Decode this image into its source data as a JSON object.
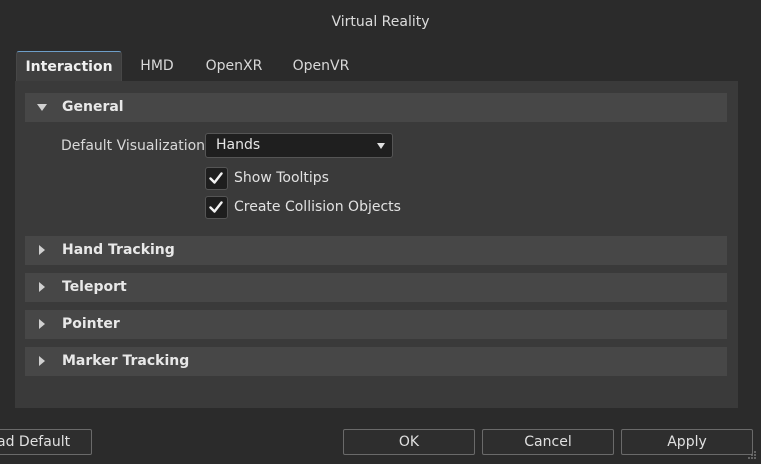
{
  "window": {
    "title": "Virtual Reality"
  },
  "tabs": [
    {
      "label": "Interaction",
      "active": true
    },
    {
      "label": "HMD",
      "active": false
    },
    {
      "label": "OpenXR",
      "active": false
    },
    {
      "label": "OpenVR",
      "active": false
    }
  ],
  "sections": {
    "general": {
      "label": "General",
      "expanded": true
    },
    "hand_tracking": {
      "label": "Hand Tracking",
      "expanded": false
    },
    "teleport": {
      "label": "Teleport",
      "expanded": false
    },
    "pointer": {
      "label": "Pointer",
      "expanded": false
    },
    "marker_tracking": {
      "label": "Marker Tracking",
      "expanded": false
    }
  },
  "general": {
    "default_visualization_label": "Default Visualization",
    "default_visualization_value": "Hands",
    "show_tooltips": {
      "label": "Show Tooltips",
      "checked": true
    },
    "create_collision_objects": {
      "label": "Create Collision Objects",
      "checked": true
    }
  },
  "buttons": {
    "load_default": "ad Default",
    "ok": "OK",
    "cancel": "Cancel",
    "apply": "Apply"
  },
  "colors": {
    "background": "#2b2b2b",
    "panel": "#3a3a3a",
    "section_header": "#474747",
    "tab_accent": "#6e9ec8"
  }
}
